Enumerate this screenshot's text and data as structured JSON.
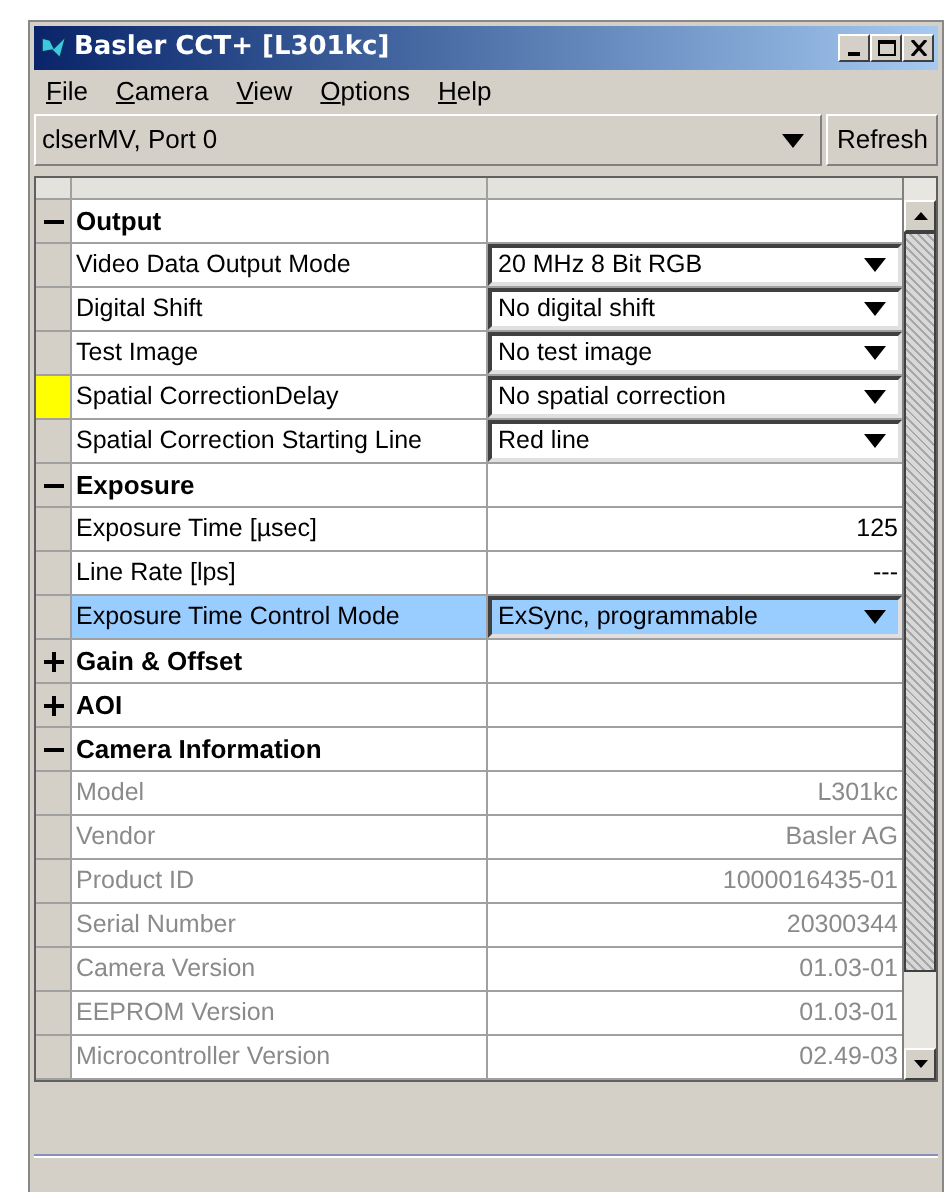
{
  "window": {
    "title": "Basler CCT+ [L301kc]"
  },
  "menu": [
    "File",
    "Camera",
    "View",
    "Options",
    "Help"
  ],
  "port_selector": {
    "value": "clserMV, Port 0"
  },
  "refresh_button": "Refresh",
  "rows": [
    {
      "kind": "group",
      "label": "Output",
      "expanded": true
    },
    {
      "kind": "dropdown",
      "label": "Video Data Output Mode",
      "value": "20 MHz 8 Bit RGB",
      "marked": false,
      "selected": false
    },
    {
      "kind": "dropdown",
      "label": "Digital Shift",
      "value": "No digital shift",
      "marked": false,
      "selected": false
    },
    {
      "kind": "dropdown",
      "label": "Test Image",
      "value": "No test image",
      "marked": false,
      "selected": false
    },
    {
      "kind": "dropdown",
      "label": "Spatial CorrectionDelay",
      "value": "No spatial correction",
      "marked": true,
      "selected": false
    },
    {
      "kind": "dropdown",
      "label": "Spatial Correction Starting Line",
      "value": "Red line",
      "marked": false,
      "selected": false
    },
    {
      "kind": "group",
      "label": "Exposure",
      "expanded": true
    },
    {
      "kind": "number",
      "label": "Exposure Time [µsec]",
      "value": "125",
      "marked": false,
      "selected": false
    },
    {
      "kind": "number",
      "label": "Line Rate [lps]",
      "value": "---",
      "marked": false,
      "selected": false
    },
    {
      "kind": "dropdown",
      "label": "Exposure Time Control Mode",
      "value": "ExSync, programmable",
      "marked": false,
      "selected": true
    },
    {
      "kind": "group",
      "label": "Gain & Offset",
      "expanded": false
    },
    {
      "kind": "group",
      "label": "AOI",
      "expanded": false
    },
    {
      "kind": "group",
      "label": "Camera Information",
      "expanded": true
    },
    {
      "kind": "info",
      "label": "Model",
      "value": "L301kc",
      "marked": false,
      "selected": false
    },
    {
      "kind": "info",
      "label": "Vendor",
      "value": "Basler AG",
      "marked": false,
      "selected": false
    },
    {
      "kind": "info",
      "label": "Product ID",
      "value": "1000016435-01",
      "marked": false,
      "selected": false
    },
    {
      "kind": "info",
      "label": "Serial Number",
      "value": "20300344",
      "marked": false,
      "selected": false
    },
    {
      "kind": "info",
      "label": "Camera Version",
      "value": "01.03-01",
      "marked": false,
      "selected": false
    },
    {
      "kind": "info",
      "label": "EEPROM Version",
      "value": "01.03-01",
      "marked": false,
      "selected": false
    },
    {
      "kind": "info",
      "label": "Microcontroller Version",
      "value": "02.49-03",
      "marked": false,
      "selected": false
    }
  ]
}
